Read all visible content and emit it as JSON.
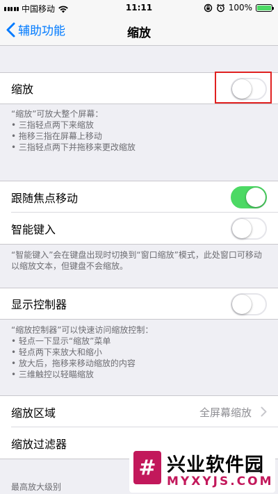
{
  "status_bar": {
    "carrier": "中国移动",
    "time": "11:11",
    "battery_text": "100%",
    "icons": [
      "signal-icon",
      "wifi-icon",
      "rotation-lock-icon",
      "alarm-icon",
      "battery-icon"
    ]
  },
  "nav": {
    "back_label": "辅助功能",
    "title": "缩放"
  },
  "zoom": {
    "label": "缩放",
    "enabled": false,
    "footer": "“缩放”可放大整个屏幕：\n• 三指轻点两下来缩放\n• 拖移三指在屏幕上移动\n• 三指轻点两下并拖移来更改缩放"
  },
  "follow_focus": {
    "label": "跟随焦点移动",
    "enabled": true
  },
  "smart_typing": {
    "label": "智能键入",
    "enabled": false,
    "footer": "“智能键入”会在键盘出现时切换到“窗口缩放”模式，此处窗口可移动以缩放文本，但键盘不会缩放。"
  },
  "show_controller": {
    "label": "显示控制器",
    "enabled": false,
    "footer": "“缩放控制器”可以快速访问缩放控制：\n• 轻点一下显示“缩放”菜单\n• 轻点两下来放大和缩小\n• 放大后，拖移来移动缩放的内容\n• 三维触控以轻瞄缩放"
  },
  "zoom_region": {
    "label": "缩放区域",
    "value": "全屏幕缩放"
  },
  "zoom_filter": {
    "label": "缩放过滤器"
  },
  "max_zoom_label": "最高放大级别",
  "watermark": {
    "title": "兴业软件园",
    "url": "MYXYJS.COM",
    "logo_glyph": "#"
  },
  "colors": {
    "accent": "#007aff",
    "switch_on": "#4cd964",
    "highlight": "#e02020",
    "brand": "#c2185b"
  }
}
